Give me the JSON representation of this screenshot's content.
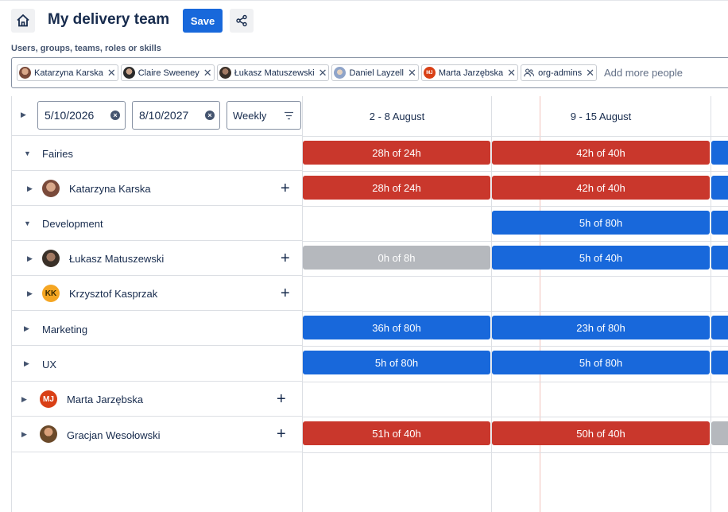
{
  "header": {
    "title": "My delivery team",
    "save_label": "Save"
  },
  "people_picker": {
    "label": "Users, groups, teams, roles or skills",
    "tags": [
      {
        "label": "Katarzyna Karska"
      },
      {
        "label": "Claire Sweeney"
      },
      {
        "label": "Łukasz Matuszewski"
      },
      {
        "label": "Daniel Layzell"
      },
      {
        "label": "Marta Jarzębska",
        "initials": "MJ"
      },
      {
        "label": "org-admins"
      }
    ],
    "add_more": "Add more people"
  },
  "controls": {
    "start_date": "5/10/2026",
    "end_date": "8/10/2027",
    "period": "Weekly"
  },
  "weeks": [
    {
      "label": "2 - 8 August"
    },
    {
      "label": "9 - 15 August"
    }
  ],
  "rows": [
    {
      "label": "Fairies",
      "expanded": true,
      "bars": [
        "28h of 24h",
        "42h of 40h"
      ]
    },
    {
      "label": "Katarzyna Karska",
      "avatar": "photo",
      "bars": [
        "28h of 24h",
        "42h of 40h"
      ]
    },
    {
      "label": "Development",
      "expanded": true,
      "bars": [
        "5h of 80h"
      ]
    },
    {
      "label": "Łukasz Matuszewski",
      "avatar": "photo",
      "bars": [
        "0h of 8h",
        "5h of 40h"
      ]
    },
    {
      "label": "Krzysztof Kasprzak",
      "initials": "KK"
    },
    {
      "label": "Marketing",
      "expanded": false,
      "bars": [
        "36h of 80h",
        "23h of 80h"
      ]
    },
    {
      "label": "UX",
      "expanded": false,
      "bars": [
        "5h of 80h",
        "5h of 80h"
      ]
    },
    {
      "label": "Marta Jarzębska",
      "initials": "MJ"
    },
    {
      "label": "Gracjan Wesołowski",
      "avatar": "photo",
      "bars": [
        "51h of 40h",
        "50h of 40h"
      ]
    }
  ],
  "colors": {
    "over": "#c9372c",
    "under": "#1868db",
    "empty": "#b5b8bd",
    "accent": "#1868db",
    "kk_avatar": "#f5a623",
    "mj_avatar": "#d94016"
  },
  "icons": {
    "home": "home-icon",
    "share": "share-icon",
    "clear": "clear-icon",
    "filter": "filter-icon",
    "expand": "caret-icon",
    "add": "plus-icon",
    "remove": "close-icon",
    "group": "people-group-icon"
  }
}
